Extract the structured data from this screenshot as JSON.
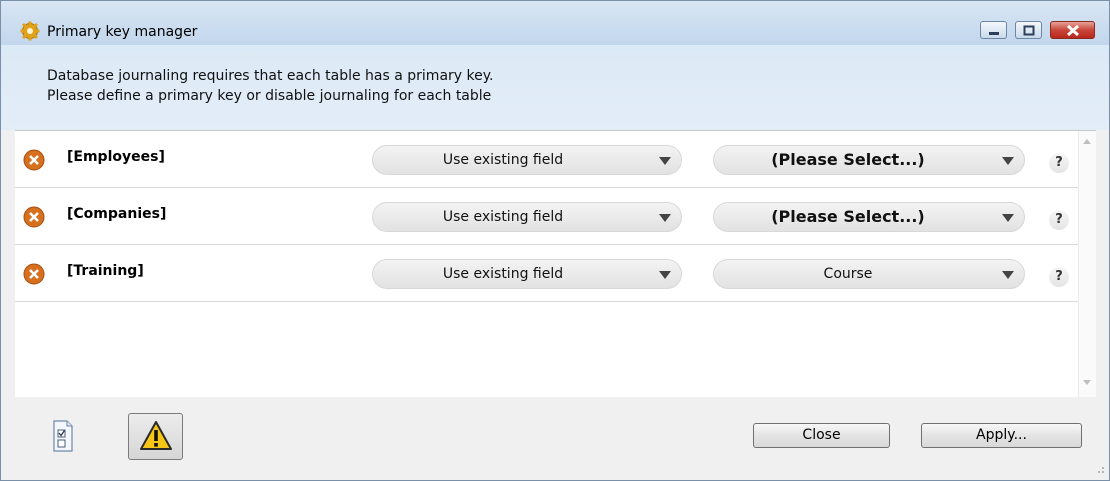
{
  "window": {
    "title": "Primary key manager",
    "icon": "gear-icon",
    "controls": [
      "minimize",
      "maximize",
      "close"
    ]
  },
  "message": {
    "line1": "Database journaling requires that each table has a primary key.",
    "line2": "Please define a primary key or disable journaling for each table"
  },
  "tables": [
    {
      "name": "[Employees]",
      "status_icon": "error-icon",
      "mode": "Use existing field",
      "field": "(Please Select...)",
      "field_placeholder": true
    },
    {
      "name": "[Companies]",
      "status_icon": "error-icon",
      "mode": "Use existing field",
      "field": "(Please Select...)",
      "field_placeholder": true
    },
    {
      "name": "[Training]",
      "status_icon": "error-icon",
      "mode": "Use existing field",
      "field": "Course",
      "field_placeholder": false
    }
  ],
  "help_label": "?",
  "footer": {
    "close_label": "Close",
    "apply_label": "Apply..."
  },
  "colors": {
    "error": "#d6701f",
    "warning": "#f5c518",
    "header_bg": "#dce9f6"
  }
}
